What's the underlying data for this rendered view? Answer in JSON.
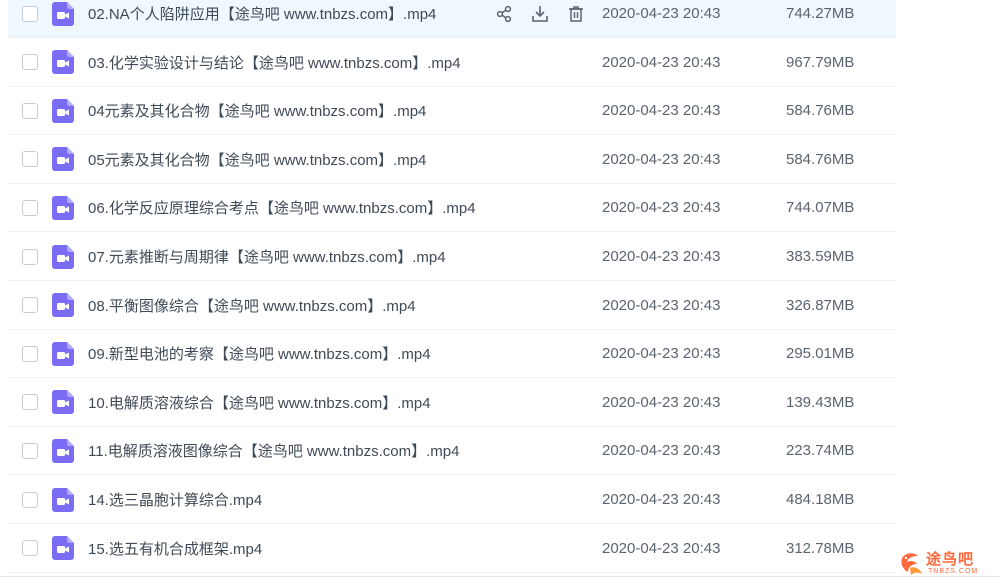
{
  "files": [
    {
      "name": "02.NA个人陷阱应用【途鸟吧 www.tnbzs.com】.mp4",
      "date": "2020-04-23 20:43",
      "size": "744.27MB",
      "hovered": true
    },
    {
      "name": "03.化学实验设计与结论【途鸟吧 www.tnbzs.com】.mp4",
      "date": "2020-04-23 20:43",
      "size": "967.79MB"
    },
    {
      "name": "04元素及其化合物【途鸟吧 www.tnbzs.com】.mp4",
      "date": "2020-04-23 20:43",
      "size": "584.76MB"
    },
    {
      "name": "05元素及其化合物【途鸟吧 www.tnbzs.com】.mp4",
      "date": "2020-04-23 20:43",
      "size": "584.76MB"
    },
    {
      "name": "06.化学反应原理综合考点【途鸟吧 www.tnbzs.com】.mp4",
      "date": "2020-04-23 20:43",
      "size": "744.07MB"
    },
    {
      "name": "07.元素推断与周期律【途鸟吧 www.tnbzs.com】.mp4",
      "date": "2020-04-23 20:43",
      "size": "383.59MB"
    },
    {
      "name": "08.平衡图像综合【途鸟吧 www.tnbzs.com】.mp4",
      "date": "2020-04-23 20:43",
      "size": "326.87MB"
    },
    {
      "name": "09.新型电池的考察【途鸟吧 www.tnbzs.com】.mp4",
      "date": "2020-04-23 20:43",
      "size": "295.01MB"
    },
    {
      "name": "10.电解质溶液综合【途鸟吧 www.tnbzs.com】.mp4",
      "date": "2020-04-23 20:43",
      "size": "139.43MB"
    },
    {
      "name": "11.电解质溶液图像综合【途鸟吧 www.tnbzs.com】.mp4",
      "date": "2020-04-23 20:43",
      "size": "223.74MB"
    },
    {
      "name": "14.选三晶胞计算综合.mp4",
      "date": "2020-04-23 20:43",
      "size": "484.18MB"
    },
    {
      "name": "15.选五有机合成框架.mp4",
      "date": "2020-04-23 20:43",
      "size": "312.78MB"
    }
  ],
  "icons": {
    "file": "video-file-icon",
    "share": "share-icon",
    "download": "download-icon",
    "delete": "delete-icon"
  },
  "colors": {
    "video_icon": "#7b6cf6",
    "hover_row": "#f0f8ff",
    "watermark": "#ff6a3c"
  },
  "watermark": {
    "text": "途鸟吧",
    "sub": "TNBZS.COM"
  }
}
